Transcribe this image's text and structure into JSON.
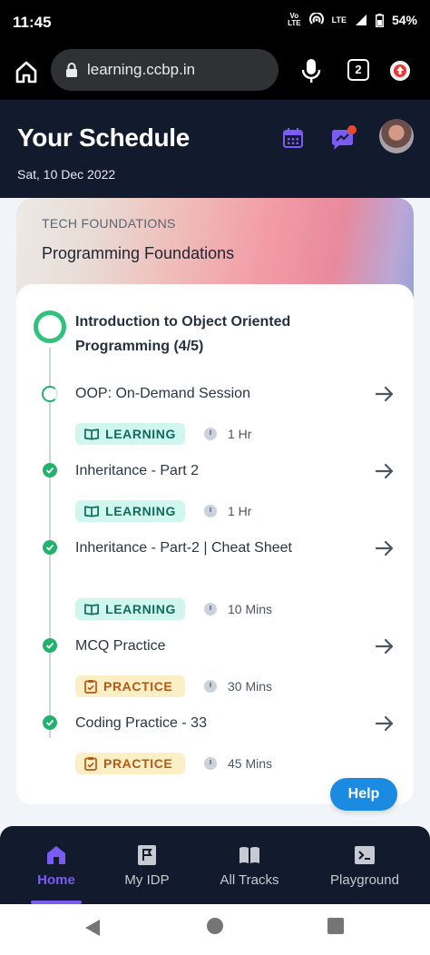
{
  "status_bar": {
    "time": "11:45",
    "volte": "Vo LTE",
    "network": "LTE",
    "battery": "54%"
  },
  "browser": {
    "url": "learning.ccbp.in",
    "tab_count": "2"
  },
  "header": {
    "title": "Your Schedule",
    "date": "Sat, 10 Dec 2022"
  },
  "course": {
    "category": "TECH FOUNDATIONS",
    "name": "Programming Foundations",
    "module_title": "Introduction to Object Oriented Programming (4/5)",
    "items": [
      {
        "title": "OOP: On-Demand Session",
        "type": "LEARNING",
        "duration": "1 Hr",
        "status": "in-progress"
      },
      {
        "title": "Inheritance - Part 2",
        "type": "LEARNING",
        "duration": "1 Hr",
        "status": "completed"
      },
      {
        "title": "Inheritance - Part-2 | Cheat Sheet",
        "type": "LEARNING",
        "duration": "10 Mins",
        "status": "completed"
      },
      {
        "title": "MCQ Practice",
        "type": "PRACTICE",
        "duration": "30 Mins",
        "status": "completed"
      },
      {
        "title": "Coding Practice - 33",
        "type": "PRACTICE",
        "duration": "45 Mins",
        "status": "completed"
      }
    ]
  },
  "help_label": "Help",
  "bottom_nav": {
    "items": [
      {
        "label": "Home",
        "icon": "home-icon",
        "active": true
      },
      {
        "label": "My IDP",
        "icon": "flag-icon",
        "active": false
      },
      {
        "label": "All Tracks",
        "icon": "book-icon",
        "active": false
      },
      {
        "label": "Playground",
        "icon": "terminal-icon",
        "active": false
      }
    ]
  },
  "colors": {
    "header_bg": "#121a2d",
    "accent": "#7b5cf2",
    "success": "#23b26d",
    "help": "#1a8be0",
    "learning_badge": "#cff7ee",
    "practice_badge": "#fcefc6"
  }
}
